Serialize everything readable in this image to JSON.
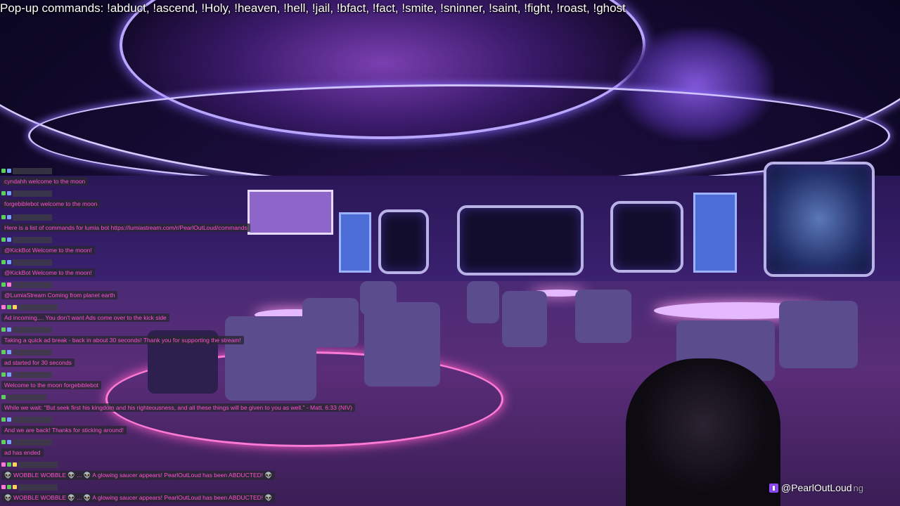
{
  "popup": {
    "text": "Pop-up commands: !abduct, !ascend, !Holy, !heaven, !hell,  !jail, !bfact, !fact, !smite, !sninner, !saint, !fight, !roast, !ghost"
  },
  "chat": {
    "messages": [
      {
        "text": "cyndahh welcome to the moon"
      },
      {
        "text": "forgebiblebot welcome to the moon"
      },
      {
        "text": "Here is a list of commands for lumia bot https://lumiastream.com/r/PearlOutLoud/commands"
      },
      {
        "text": "@KickBot Welcome to the moon!"
      },
      {
        "text": "@KickBot Welcome to the moon!"
      },
      {
        "text": "@LumiaStream Coming from planet earth"
      },
      {
        "text": "Ad incoming.... You don't want Ads come over to the kick side"
      },
      {
        "text": "Taking a quick ad break - back in about 30 seconds! Thank you for supporting the stream!"
      },
      {
        "text": "ad started for 30 seconds"
      },
      {
        "text": "Welcome to the moon forgebiblebot"
      },
      {
        "text": "While we wait: \"But seek first his kingdom and his righteousness, and all these things will be given to you as well.\" - Matt. 6:33 (NIV)"
      },
      {
        "text": "And we are back! Thanks for sticking around!"
      },
      {
        "text": "ad has ended"
      },
      {
        "text": "👽 WOBBLE WOBBLE 👽 ... 👽 A glowing saucer appears! PearlOutLoud has been ABDUCTED! 👽"
      },
      {
        "text": "👽 WOBBLE WOBBLE 👽 ... 👽 A glowing saucer appears! PearlOutLoud has been ABDUCTED! 👽"
      }
    ]
  },
  "footer": {
    "handle": "@PearlOutLoud",
    "trailing": "ng",
    "platform_icon": "twitch-icon"
  },
  "colors": {
    "chat_text": "#ff4fd2",
    "twitch": "#9146ff"
  }
}
